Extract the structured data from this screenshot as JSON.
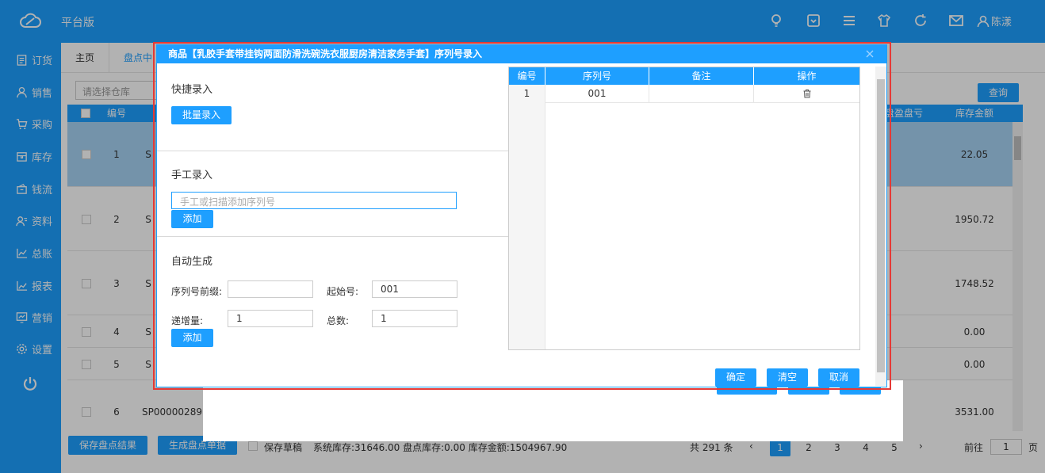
{
  "topbar": {
    "brand": "平台版",
    "user_name": "陈漾",
    "icons": [
      "bulb-icon",
      "box-icon",
      "menu-icon",
      "shirt-icon",
      "refresh-icon",
      "mail-icon",
      "user-icon"
    ]
  },
  "sidebar": {
    "items": [
      {
        "label": "订货",
        "icon": "clipboard-icon"
      },
      {
        "label": "销售",
        "icon": "person-icon"
      },
      {
        "label": "采购",
        "icon": "cart-icon"
      },
      {
        "label": "库存",
        "icon": "box-icon"
      },
      {
        "label": "钱流",
        "icon": "wallet-icon"
      },
      {
        "label": "资料",
        "icon": "contacts-icon"
      },
      {
        "label": "总账",
        "icon": "chart-icon"
      },
      {
        "label": "报表",
        "icon": "report-icon"
      },
      {
        "label": "营销",
        "icon": "monitor-icon"
      },
      {
        "label": "设置",
        "icon": "gear-icon"
      }
    ]
  },
  "tabs": {
    "home": "主页",
    "active": "盘点中"
  },
  "filter": {
    "warehouse_placeholder": "请选择仓库",
    "query_label": "查询"
  },
  "grid": {
    "headers": {
      "num": "编号",
      "diff": "盘盈盘亏",
      "amount": "库存金额"
    },
    "rows": [
      {
        "num": "1",
        "code": "S",
        "amount": "22.05"
      },
      {
        "num": "2",
        "code": "S",
        "amount": "1950.72"
      },
      {
        "num": "3",
        "code": "S",
        "amount": "1748.52"
      },
      {
        "num": "4",
        "code": "S",
        "amount": "0.00"
      },
      {
        "num": "5",
        "code": "S",
        "amount": "0.00"
      },
      {
        "num": "6",
        "code": "SP00000289",
        "amount": "3531.00"
      }
    ]
  },
  "bottom": {
    "save_result": "保存盘点结果",
    "gen_doc": "生成盘点单据",
    "save_draft": "保存草稿",
    "stats": "系统库存:31646.00  盘点库存:0.00  库存金额:1504967.90",
    "total": "共 291 条",
    "pages": [
      "1",
      "2",
      "3",
      "4",
      "5"
    ],
    "goto_label": "前往",
    "goto_value": "1",
    "page_suffix": "页"
  },
  "modal": {
    "title": "商品【乳胶手套带挂钩两面防滑洗碗洗衣服厨房清洁家务手套】序列号录入",
    "quick_title": "快捷录入",
    "batch_btn": "批量录入",
    "manual_title": "手工录入",
    "manual_placeholder": "手工或扫描添加序列号",
    "add_btn": "添加",
    "auto_title": "自动生成",
    "prefix_label": "序列号前缀:",
    "start_label": "起始号:",
    "start_value": "001",
    "step_label": "递增量:",
    "step_value": "1",
    "count_label": "总数:",
    "count_value": "1",
    "add_btn2": "添加",
    "table_headers": {
      "num": "编号",
      "sn": "序列号",
      "note": "备注",
      "op": "操作"
    },
    "table_rows": [
      {
        "num": "1",
        "sn": "001",
        "note": ""
      }
    ],
    "confirm": "确定",
    "clear": "清空",
    "cancel": "取消"
  }
}
